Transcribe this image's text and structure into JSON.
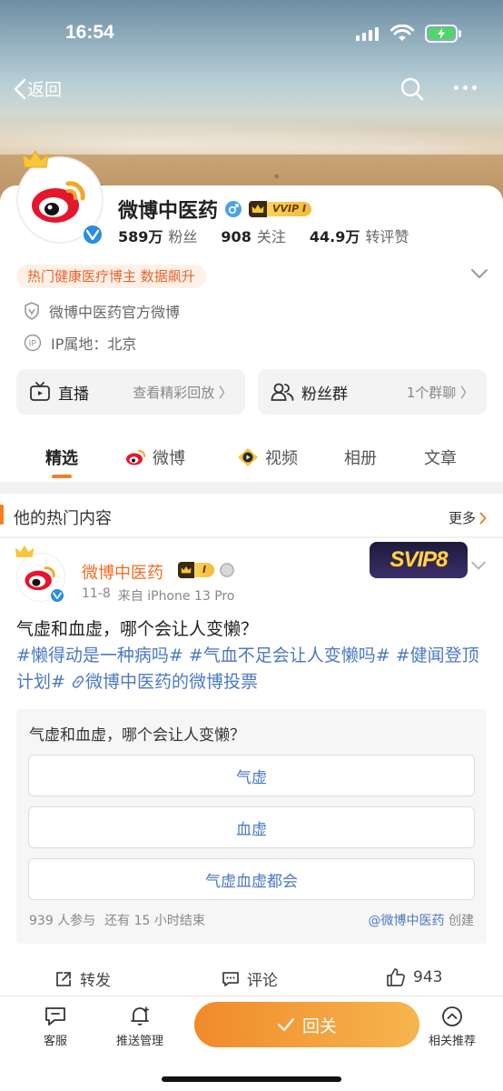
{
  "status_bar": {
    "time": "16:54"
  },
  "nav": {
    "back_label": "返回"
  },
  "profile": {
    "name": "微博中医药",
    "vip_label": "VVIP I",
    "stats": [
      {
        "value": "589万",
        "label": "粉丝"
      },
      {
        "value": "908",
        "label": "关注"
      },
      {
        "value": "44.9万",
        "label": "转评赞"
      }
    ],
    "hot_tag": "热门健康医疗博主 数据飙升",
    "verification": "微博中医药官方微博",
    "ip_location": "IP属地：北京",
    "accent_color": "#f47f24"
  },
  "quick_links": [
    {
      "title": "直播",
      "sub": "查看精彩回放 〉"
    },
    {
      "title": "粉丝群",
      "sub": "1个群聊 〉"
    }
  ],
  "tabs": [
    {
      "label": "精选",
      "active": true
    },
    {
      "label": "微博",
      "active": false
    },
    {
      "label": "视频",
      "active": false
    },
    {
      "label": "相册",
      "active": false
    },
    {
      "label": "文章",
      "active": false
    }
  ],
  "hot_section": {
    "title": "他的热门内容",
    "more_label": "更多"
  },
  "post": {
    "author": "微博中医药",
    "vip_label": "I",
    "svip_badge": "SVIP8",
    "date": "11-8",
    "source": "来自 iPhone 13 Pro",
    "text_plain": "气虚和血虚，哪个会让人变懒？",
    "hashtags": "#懒得动是一种病吗# #气血不足会让人变懒吗# #健闻登顶计划#",
    "vote_link": "微博中医药的微博投票",
    "poll": {
      "question": "气虚和血虚，哪个会让人变懒？",
      "options": [
        "气虚",
        "血虚",
        "气虚血虚都会"
      ],
      "participants": "939 人参与",
      "remaining": "还有 15 小时结束",
      "creator": "@微博中医药",
      "creator_suffix": "创建"
    },
    "actions": {
      "repost": "转发",
      "comment": "评论",
      "likes": "943"
    }
  },
  "bottom_bar": {
    "service": "客服",
    "push_manage": "推送管理",
    "follow_back": "回关",
    "related": "相关推荐"
  }
}
